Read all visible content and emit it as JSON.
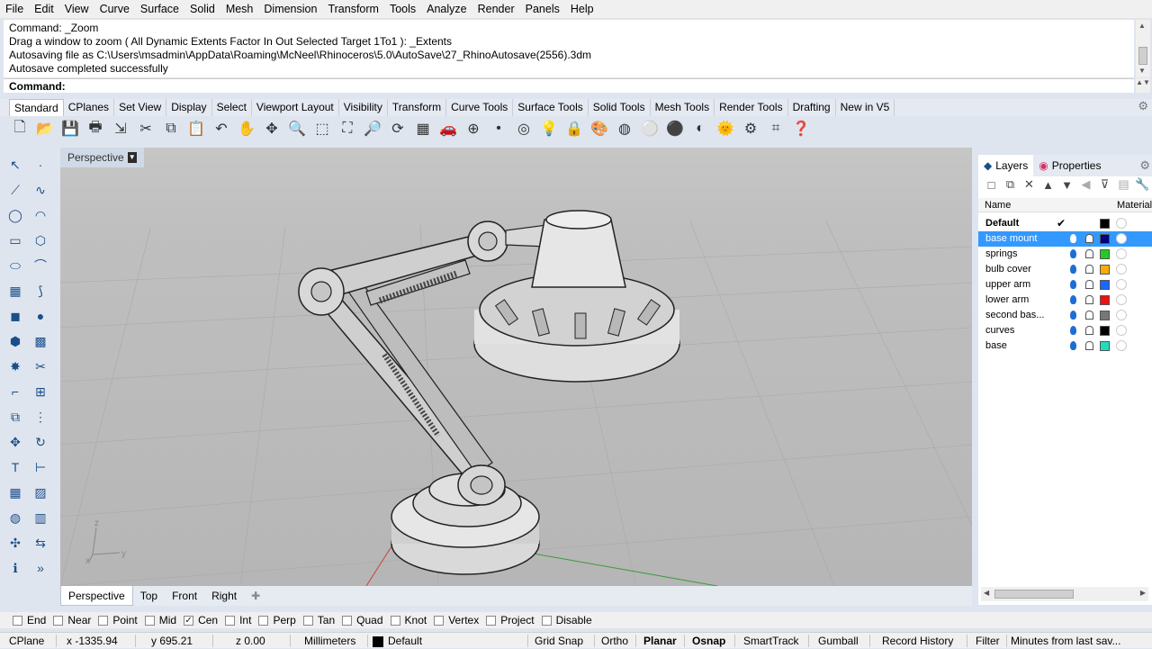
{
  "menu": [
    "File",
    "Edit",
    "View",
    "Curve",
    "Surface",
    "Solid",
    "Mesh",
    "Dimension",
    "Transform",
    "Tools",
    "Analyze",
    "Render",
    "Panels",
    "Help"
  ],
  "history": [
    "Command: _Zoom",
    "Drag a window to zoom ( All  Dynamic  Extents  Factor  In  Out  Selected  Target  1To1 ): _Extents",
    "Autosaving file as C:\\Users\\msadmin\\AppData\\Roaming\\McNeel\\Rhinoceros\\5.0\\AutoSave\\27_RhinoAutosave(2556).3dm",
    "Autosave completed successfully"
  ],
  "command_prompt": "Command:",
  "toolbar_tabs": [
    "Standard",
    "CPlanes",
    "Set View",
    "Display",
    "Select",
    "Viewport Layout",
    "Visibility",
    "Transform",
    "Curve Tools",
    "Surface Tools",
    "Solid Tools",
    "Mesh Tools",
    "Render Tools",
    "Drafting",
    "New in V5"
  ],
  "toolbar_icons": [
    "new-file-icon",
    "open-icon",
    "save-icon",
    "print-icon",
    "import-icon",
    "cut-icon",
    "copy-icon",
    "paste-icon",
    "undo-icon",
    "pan-icon",
    "move-icon",
    "zoom-icon",
    "zoom-window-icon",
    "zoom-extents-icon",
    "zoom-selected-icon",
    "rotate-view-icon",
    "grid-icon",
    "car-icon",
    "move-ucs-icon",
    "point-icon",
    "osnap-icon",
    "light-icon",
    "lock-icon",
    "material-icon",
    "color-wheel-icon",
    "sphere-icon",
    "render-icon",
    "shade-icon",
    "sun-icon",
    "gear-tools-icon",
    "history-icon",
    "help-icon"
  ],
  "viewport": {
    "title": "Perspective"
  },
  "view_tabs": [
    "Perspective",
    "Top",
    "Front",
    "Right"
  ],
  "axis_labels": {
    "z": "z",
    "y": "y",
    "x": "x"
  },
  "panel": {
    "tabs": [
      "Layers",
      "Properties"
    ],
    "col_name": "Name",
    "col_material": "Material",
    "layers": [
      {
        "name": "Default",
        "color": "#000000",
        "current": true
      },
      {
        "name": "base mount",
        "color": "#000080",
        "selected": true
      },
      {
        "name": "springs",
        "color": "#22cc22"
      },
      {
        "name": "bulb cover",
        "color": "#ffaa00"
      },
      {
        "name": "upper arm",
        "color": "#1a66ff"
      },
      {
        "name": "lower arm",
        "color": "#ee1111"
      },
      {
        "name": "second bas...",
        "color": "#777777"
      },
      {
        "name": "curves",
        "color": "#000000"
      },
      {
        "name": "base",
        "color": "#22ddbb"
      }
    ]
  },
  "osnaps": [
    {
      "label": "End",
      "checked": false
    },
    {
      "label": "Near",
      "checked": false
    },
    {
      "label": "Point",
      "checked": false
    },
    {
      "label": "Mid",
      "checked": false
    },
    {
      "label": "Cen",
      "checked": true
    },
    {
      "label": "Int",
      "checked": false
    },
    {
      "label": "Perp",
      "checked": false
    },
    {
      "label": "Tan",
      "checked": false
    },
    {
      "label": "Quad",
      "checked": false
    },
    {
      "label": "Knot",
      "checked": false
    },
    {
      "label": "Vertex",
      "checked": false
    },
    {
      "label": "Project",
      "checked": false
    },
    {
      "label": "Disable",
      "checked": false
    }
  ],
  "status": {
    "cplane": "CPlane",
    "x": "x -1335.94",
    "y": "y 695.21",
    "z": "z 0.00",
    "units": "Millimeters",
    "layer": "Default",
    "grid_snap": "Grid Snap",
    "ortho": "Ortho",
    "planar": "Planar",
    "osnap": "Osnap",
    "smarttrack": "SmartTrack",
    "gumball": "Gumball",
    "record_history": "Record History",
    "filter": "Filter",
    "autosave": "Minutes from last sav..."
  }
}
